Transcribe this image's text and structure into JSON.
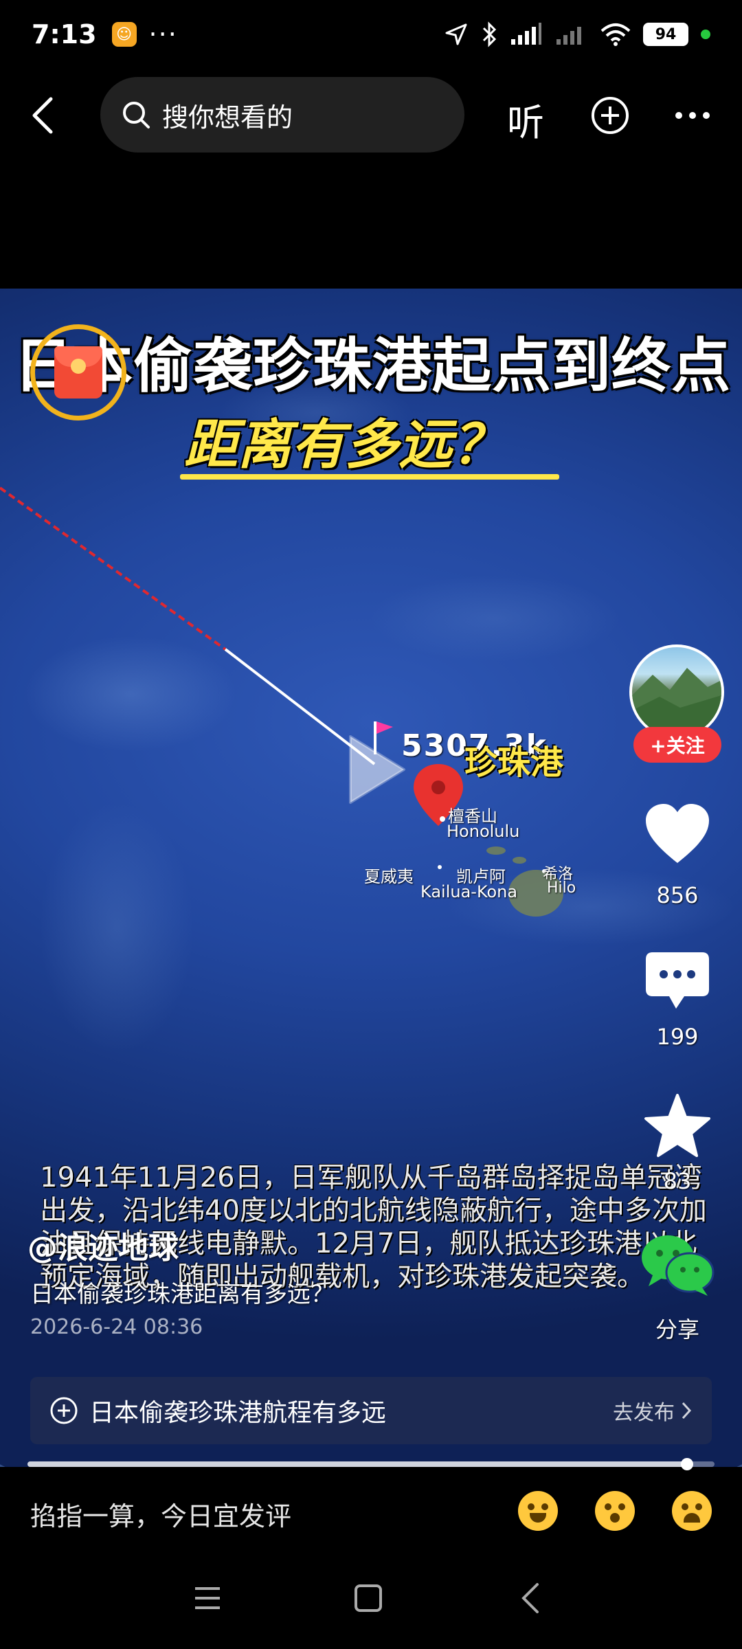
{
  "status_bar": {
    "time": "7:13",
    "more": "···",
    "battery": "94",
    "icons": [
      "app-badge-icon",
      "location-icon",
      "bluetooth-icon",
      "signal-icon",
      "wifi-icon",
      "battery-icon"
    ]
  },
  "top_nav": {
    "search_placeholder": "搜你想看的",
    "listen_label": "听",
    "icons": [
      "back-icon",
      "search-icon",
      "plus-circle-icon",
      "more-icon"
    ]
  },
  "video": {
    "title_main": "日本偷袭珍珠港起点到终点",
    "title_sub": "距离有多远？",
    "map_labels": {
      "distance": "5307.3k",
      "pearl_harbor": "珍珠港",
      "honolulu_cn": "檀香山",
      "honolulu": "Honolulu",
      "hawaii_cn": "夏威夷",
      "kailua_cn": "凯卢阿",
      "kailua": "Kailua-Kona",
      "hilo_cn": "希洛",
      "hilo": "Hilo"
    },
    "caption": "1941年11月26日，日军舰队从千岛群岛择捉岛单冠湾出发，沿北纬40度以北的北航线隐蔽航行，途中多次加油且保持无线电静默。12月7日，舰队抵达珍珠港以北预定海域，随即出动舰载机，对珍珠港发起突袭。"
  },
  "right_rail": {
    "follow_label": "+关注",
    "like_count": "856",
    "comment_count": "199",
    "favorite_count": "83",
    "share_label": "分享"
  },
  "author": {
    "name": "@浪迹地球",
    "description": "日本偷袭珍珠港距离有多远？",
    "date": "2026-6-24 08:36"
  },
  "topic_bar": {
    "text": "日本偷袭珍珠港航程有多远",
    "action": "去发布"
  },
  "progress": {
    "fraction": 0.96
  },
  "comment_bar": {
    "placeholder": "掐指一算，今日宜发评",
    "emojis": [
      "laughing-emoji-icon",
      "wink-emoji-icon",
      "crying-emoji-icon"
    ]
  },
  "system_nav": [
    "menu-icon",
    "home-icon",
    "back-nav-icon"
  ],
  "colors": {
    "follow_red": "#f2383d",
    "title_yellow": "#ffe84a",
    "ocean_blue": "#22479f"
  }
}
